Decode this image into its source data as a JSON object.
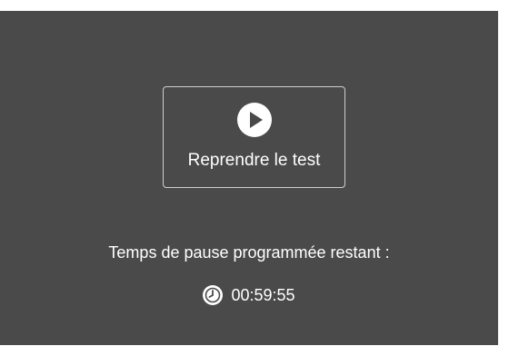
{
  "resume": {
    "label": "Reprendre le test",
    "icon": "play-icon"
  },
  "pause": {
    "label": "Temps de pause programmée restant :",
    "icon": "clock-icon",
    "remaining": "00:59:55"
  },
  "colors": {
    "panel_background": "#4a4a4a",
    "text": "#ffffff",
    "button_border": "#cfcfcf"
  }
}
